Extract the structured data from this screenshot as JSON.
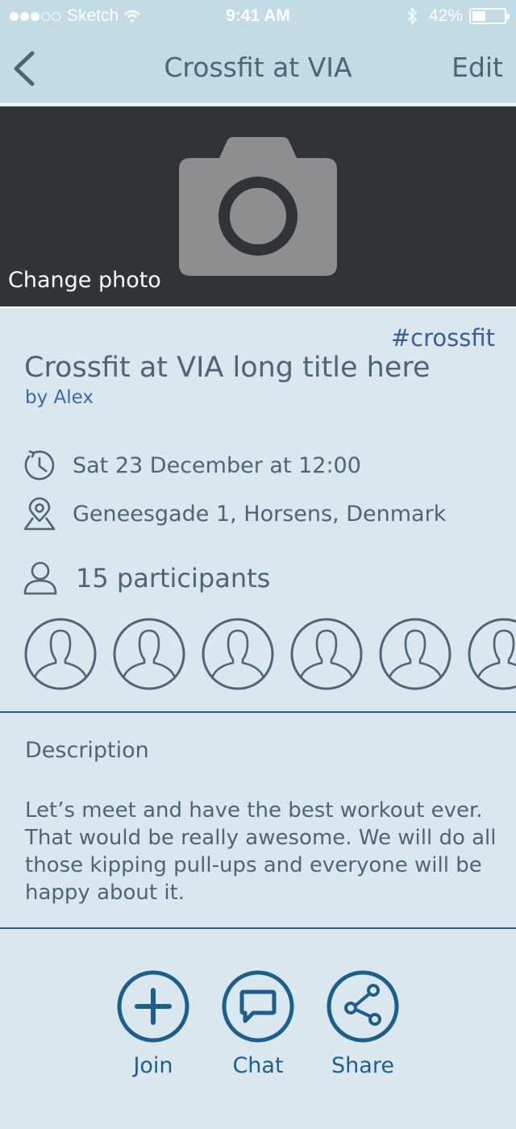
{
  "status_bar": {
    "carrier": "Sketch",
    "time": "9:41 AM",
    "battery_percent": "42%",
    "battery_level": 0.42,
    "signal_dots": 5,
    "signal_filled": 3
  },
  "nav": {
    "title": "Crossfit at VIA",
    "edit_label": "Edit",
    "back_icon": "chevron-left-icon"
  },
  "photo": {
    "change_label": "Change photo",
    "icon": "camera-icon"
  },
  "event": {
    "hashtag": "#crossfit",
    "title": "Crossfit at VIA long title here",
    "author": "by Alex",
    "datetime": "Sat 23 December at 12:00",
    "location": "Geneesgade 1, Horsens, Denmark",
    "participants": "15 participants"
  },
  "description": {
    "label": "Description",
    "text": "Let’s meet and have the best workout ever. That would be really awesome. We will do all those kipping pull-ups and everyone will be happy about it."
  },
  "actions": [
    {
      "label": "Join",
      "icon": "plus-icon"
    },
    {
      "label": "Chat",
      "icon": "chat-icon"
    },
    {
      "label": "Share",
      "icon": "share-icon"
    }
  ],
  "colors": {
    "background": "#dbe7ef",
    "header": "#c3dbe4",
    "photo_bg": "#323337",
    "text": "#4e6577",
    "link": "#3a6aa6",
    "accent": "#1d5e8c"
  }
}
